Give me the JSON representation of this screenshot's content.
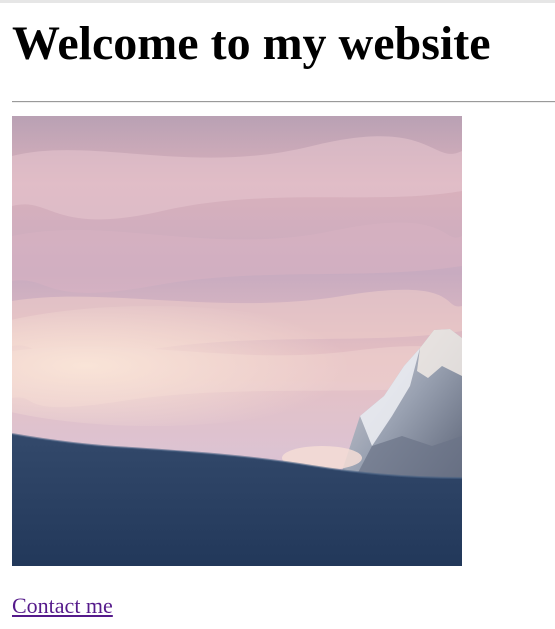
{
  "page": {
    "title": "Welcome to my website",
    "contact_link": "Contact me"
  },
  "colors": {
    "link": "#551a8b",
    "text": "#000000",
    "background": "#ffffff"
  },
  "image": {
    "subject": "mountain-sunset-photo"
  }
}
